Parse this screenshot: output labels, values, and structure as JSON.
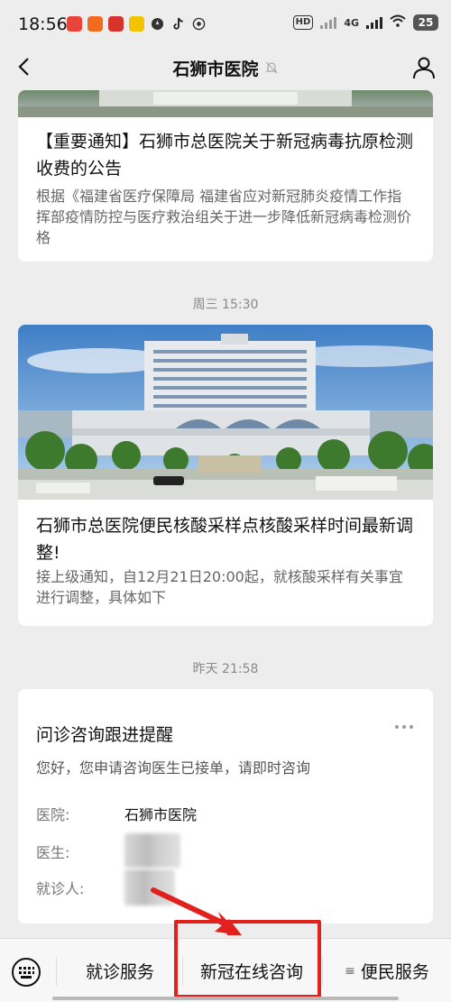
{
  "status_bar": {
    "time": "18:56",
    "hd": "HD",
    "network": "4G",
    "battery": "25"
  },
  "nav": {
    "title": "石狮市医院"
  },
  "article1": {
    "title": "【重要通知】石狮市总医院关于新冠病毒抗原检测收费的公告",
    "summary": "根据《福建省医疗保障局 福建省应对新冠肺炎疫情工作指挥部疫情防控与医疗救治组关于进一步降低新冠病毒检测价格"
  },
  "timestamps": {
    "wed": "周三 15:30",
    "yesterday": "昨天 21:58"
  },
  "article2": {
    "title": "石狮市总医院便民核酸采样点核酸采样时间最新调整!",
    "summary": "接上级通知，自12月21日20:00起，就核酸采样有关事宜进行调整，具体如下"
  },
  "reminder": {
    "title": "问诊咨询跟进提醒",
    "description": "您好，您申请咨询医生已接单，请即时咨询",
    "hospital_label": "医院:",
    "hospital_value": "石狮市医院",
    "doctor_label": "医生:",
    "patient_label": "就诊人:"
  },
  "menu": {
    "item1": "就诊服务",
    "item2": "新冠在线咨询",
    "item3": "便民服务",
    "item3_prefix": "≡"
  },
  "colors": {
    "highlight": "#e0211e",
    "background": "#ededed"
  }
}
